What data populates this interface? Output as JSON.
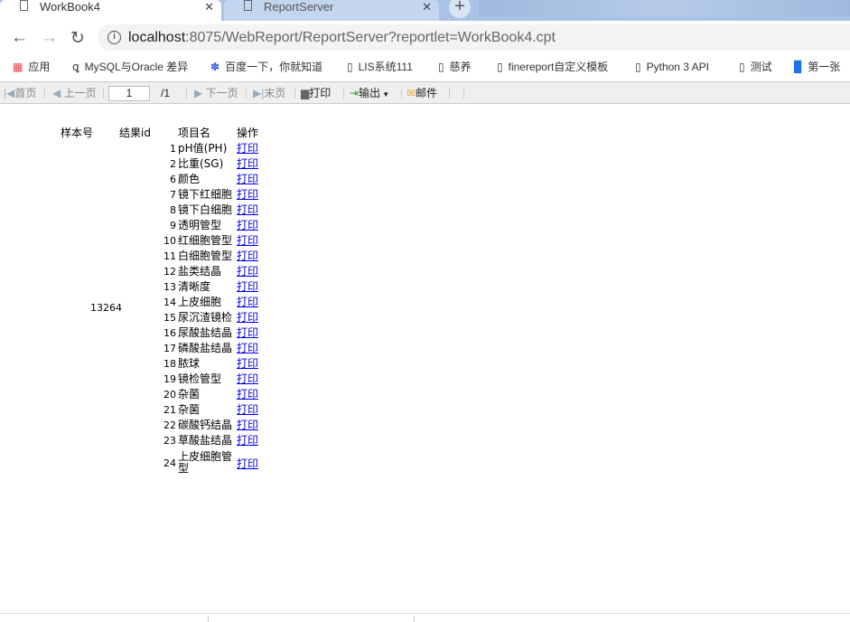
{
  "tabs": [
    {
      "title": "WorkBook4",
      "active": true
    },
    {
      "title": "ReportServer",
      "active": false
    }
  ],
  "address": {
    "host": "localhost",
    "rest": ":8075/WebReport/ReportServer?reportlet=WorkBook4.cpt"
  },
  "bookmarks": [
    "应用",
    "MySQL与Oracle 差异",
    "百度一下，你就知道",
    "LIS系统111",
    "慈养",
    "finereport自定义模板",
    "Python 3 API",
    "测试",
    "第一张"
  ],
  "report_toolbar": {
    "first": "首页",
    "prev": "上一页",
    "page": "1",
    "total": "/1",
    "next": "下一页",
    "last": "末页",
    "print": "打印",
    "export": "输出",
    "email": "邮件"
  },
  "report": {
    "headers": [
      "样本号",
      "结果id",
      "项目名",
      "操作"
    ],
    "sample_id": "13264",
    "rows": [
      {
        "id": "1",
        "name": "pH值(PH)",
        "action": "打印"
      },
      {
        "id": "2",
        "name": "比重(SG)",
        "action": "打印"
      },
      {
        "id": "6",
        "name": "颜色",
        "action": "打印"
      },
      {
        "id": "7",
        "name": "镜下红细胞",
        "action": "打印"
      },
      {
        "id": "8",
        "name": "镜下白细胞",
        "action": "打印"
      },
      {
        "id": "9",
        "name": "透明管型",
        "action": "打印"
      },
      {
        "id": "10",
        "name": "红细胞管型",
        "action": "打印"
      },
      {
        "id": "11",
        "name": "白细胞管型",
        "action": "打印"
      },
      {
        "id": "12",
        "name": "盐类结晶",
        "action": "打印"
      },
      {
        "id": "13",
        "name": "清晰度",
        "action": "打印"
      },
      {
        "id": "14",
        "name": "上皮细胞",
        "action": "打印"
      },
      {
        "id": "15",
        "name": "尿沉渣镜检",
        "action": "打印"
      },
      {
        "id": "16",
        "name": "尿酸盐结晶",
        "action": "打印"
      },
      {
        "id": "17",
        "name": "磷酸盐结晶",
        "action": "打印"
      },
      {
        "id": "18",
        "name": "脓球",
        "action": "打印"
      },
      {
        "id": "19",
        "name": "镜检管型",
        "action": "打印"
      },
      {
        "id": "20",
        "name": "杂菌",
        "action": "打印"
      },
      {
        "id": "21",
        "name": "杂菌",
        "action": "打印"
      },
      {
        "id": "22",
        "name": "碳酸钙结晶",
        "action": "打印"
      },
      {
        "id": "23",
        "name": "草酸盐结晶",
        "action": "打印"
      },
      {
        "id": "24",
        "name": "上皮细胞管型",
        "action": "打印"
      }
    ]
  }
}
